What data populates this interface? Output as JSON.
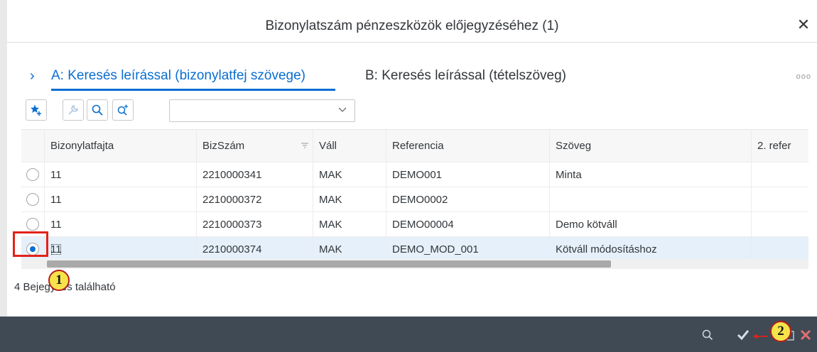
{
  "dialog": {
    "title": "Bizonylatszám pénzeszközök előjegyzéséhez (1)",
    "close_icon": "close-icon"
  },
  "tabs": [
    {
      "label": "A: Keresés leírással (bizonylatfej szövege)",
      "active": true
    },
    {
      "label": "B: Keresés leírással (tételszöveg)",
      "active": false
    }
  ],
  "tabs_overflow": "ooo",
  "toolbar": {
    "icons": [
      "favorite-add-icon",
      "wrench-icon",
      "search-icon",
      "zoom-in-icon"
    ],
    "select_value": ""
  },
  "table": {
    "columns": [
      "Bizonylatfajta",
      "BizSzám",
      "Váll",
      "Referencia",
      "Szöveg",
      "2. refer"
    ],
    "rows": [
      {
        "selected": false,
        "cells": [
          "11",
          "2210000341",
          "MAK",
          "DEMO001",
          "Minta",
          ""
        ]
      },
      {
        "selected": false,
        "cells": [
          "11",
          "2210000372",
          "MAK",
          "DEMO0002",
          "",
          ""
        ]
      },
      {
        "selected": false,
        "cells": [
          "11",
          "2210000373",
          "MAK",
          "DEMO00004",
          "Demo kötváll",
          ""
        ]
      },
      {
        "selected": true,
        "cells": [
          "11",
          "2210000374",
          "MAK",
          "DEMO_MOD_001",
          "Kötváll módosításhoz",
          ""
        ]
      }
    ]
  },
  "status": {
    "count_text": "4 Bejegyzés található"
  },
  "footer": {
    "icons": [
      "search-icon",
      "check-icon",
      "copy-icon",
      "cancel-icon"
    ]
  },
  "callouts": [
    "1",
    "2"
  ],
  "colors": {
    "accent": "#0a6ed1",
    "footer_bg": "#3f4a55",
    "callout_fill": "#f6e34a",
    "highlight_red": "#e32219",
    "selected_row": "#e5f0fa"
  }
}
